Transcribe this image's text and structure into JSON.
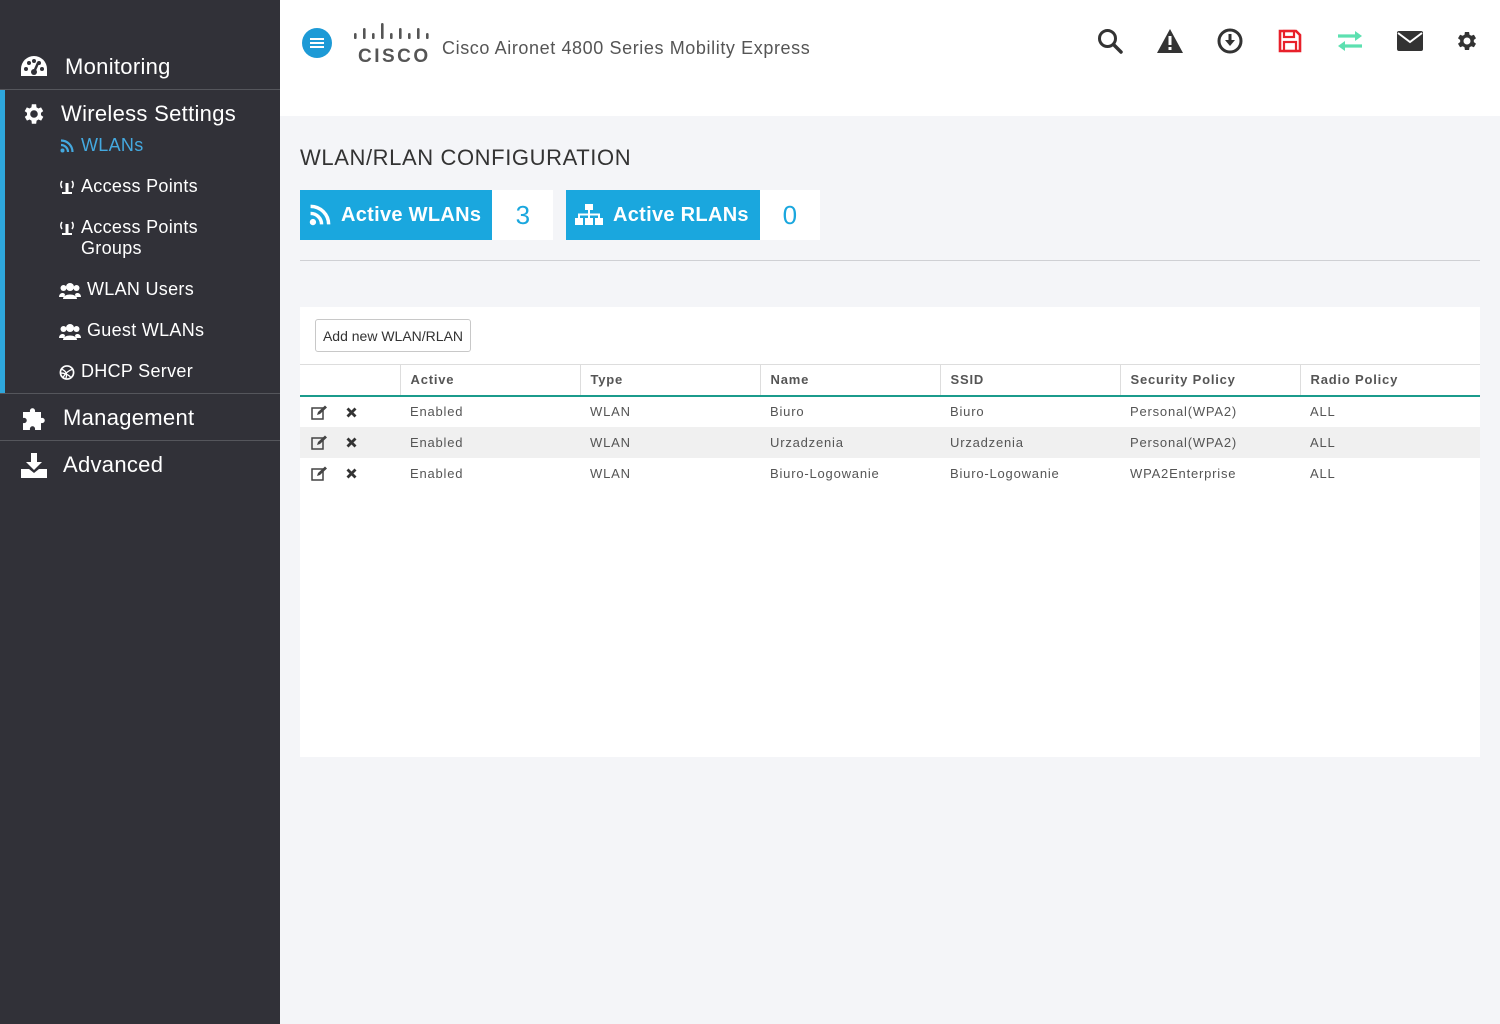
{
  "sidebar": {
    "monitoring": "Monitoring",
    "wireless_settings": "Wireless Settings",
    "items": [
      {
        "label": "WLANs"
      },
      {
        "label": "Access Points"
      },
      {
        "label": "Access Points Groups"
      },
      {
        "label": "WLAN Users"
      },
      {
        "label": "Guest WLANs"
      },
      {
        "label": "DHCP Server"
      }
    ],
    "management": "Management",
    "advanced": "Advanced"
  },
  "header": {
    "logo_text": "CISCO",
    "product": "Cisco Aironet 4800 Series Mobility Express",
    "icons": [
      "search-icon",
      "alert-icon",
      "download-icon",
      "save-icon",
      "transfer-icon",
      "mail-icon",
      "gear-icon"
    ]
  },
  "page": {
    "title": "WLAN/RLAN CONFIGURATION",
    "active_wlans_label": "Active WLANs",
    "active_wlans_count": "3",
    "active_rlans_label": "Active RLANs",
    "active_rlans_count": "0",
    "add_button": "Add new WLAN/RLAN"
  },
  "table": {
    "columns": [
      "Active",
      "Type",
      "Name",
      "SSID",
      "Security Policy",
      "Radio Policy"
    ],
    "rows": [
      {
        "active": "Enabled",
        "type": "WLAN",
        "name": "Biuro",
        "ssid": "Biuro",
        "security": "Personal(WPA2)",
        "radio": "ALL"
      },
      {
        "active": "Enabled",
        "type": "WLAN",
        "name": "Urzadzenia",
        "ssid": "Urzadzenia",
        "security": "Personal(WPA2)",
        "radio": "ALL"
      },
      {
        "active": "Enabled",
        "type": "WLAN",
        "name": "Biuro-Logowanie",
        "ssid": "Biuro-Logowanie",
        "security": "WPA2Enterprise",
        "radio": "ALL"
      }
    ]
  },
  "colors": {
    "accent": "#1aa7de",
    "sidebar_bg": "#313138",
    "save_icon": "#e8202a",
    "transfer_icon": "#5de0b0"
  }
}
